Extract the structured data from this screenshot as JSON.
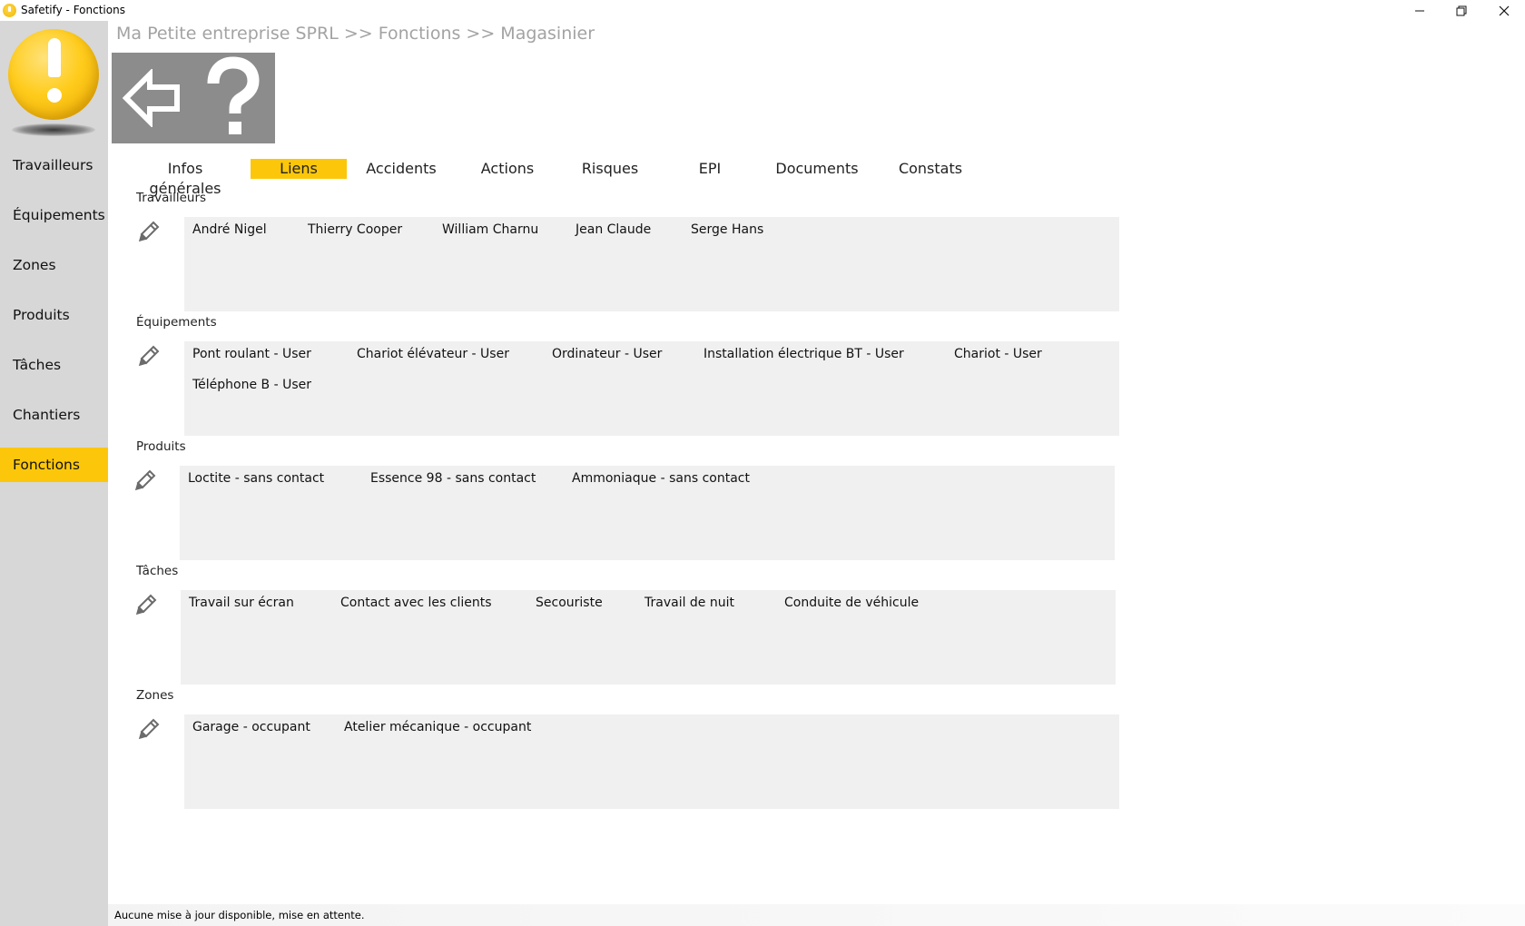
{
  "window": {
    "title": "Safetify - Fonctions"
  },
  "sidebar": {
    "items": [
      {
        "label": "Travailleurs"
      },
      {
        "label": "Équipements"
      },
      {
        "label": "Zones"
      },
      {
        "label": "Produits"
      },
      {
        "label": "Tâches"
      },
      {
        "label": "Chantiers"
      },
      {
        "label": "Fonctions",
        "active": true
      }
    ]
  },
  "breadcrumb": "Ma Petite entreprise SPRL >> Fonctions >> Magasinier",
  "toolbar": {
    "back_icon": "arrow-left-icon",
    "help_icon": "question-mark-icon"
  },
  "tabs": [
    {
      "label": "Infos générales"
    },
    {
      "label": "Liens",
      "active": true
    },
    {
      "label": "Accidents"
    },
    {
      "label": "Actions"
    },
    {
      "label": "Risques"
    },
    {
      "label": "EPI"
    },
    {
      "label": "Documents"
    },
    {
      "label": "Constats"
    }
  ],
  "sections": {
    "travailleurs": {
      "title": "Travailleurs",
      "items": [
        "André Nigel",
        "Thierry Cooper",
        "William Charnu",
        "Jean Claude",
        "Serge Hans"
      ]
    },
    "equipements": {
      "title": "Équipements",
      "items": [
        "Pont roulant - User",
        "Chariot élévateur - User",
        "Ordinateur - User",
        "Installation électrique BT - User",
        "Chariot - User",
        "Téléphone B - User"
      ]
    },
    "produits": {
      "title": "Produits",
      "items": [
        "Loctite - sans contact",
        "Essence 98 - sans contact",
        "Ammoniaque - sans contact"
      ]
    },
    "taches": {
      "title": "Tâches",
      "items": [
        "Travail sur écran",
        "Contact avec les clients",
        "Secouriste",
        "Travail de nuit",
        "Conduite de véhicule"
      ]
    },
    "zones": {
      "title": "Zones",
      "items": [
        "Garage - occupant",
        "Atelier mécanique - occupant"
      ]
    }
  },
  "status": "Aucune mise à jour disponible, mise en attente.",
  "colors": {
    "accent": "#fcc70a",
    "sidebar_bg": "#d7d7d7",
    "box_bg": "#f0f0f0",
    "toolbar_bg": "#8c8c8c"
  }
}
